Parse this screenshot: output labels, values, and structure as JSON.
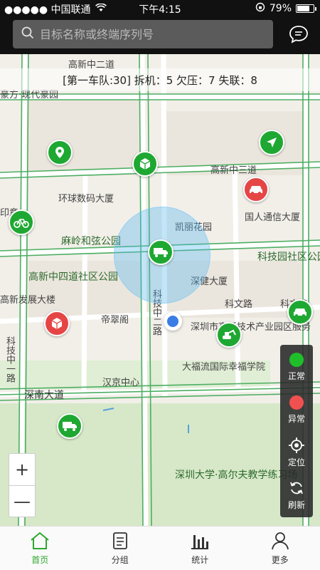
{
  "status_bar": {
    "carrier": "●●●●● 中国联通",
    "time": "下午4:15",
    "battery": "79%",
    "battery_level": 0.79
  },
  "search": {
    "placeholder": "目标名称或终端序列号"
  },
  "summary": {
    "text": "[第一车队:30]  拆机：5  欠压：7  失联：8"
  },
  "map": {
    "labels": {
      "gaoxin_zhong2": "高新中二道",
      "haofang": "豪方·现代豪园",
      "gaoxin_zhong3": "高新中三道",
      "huanqiu": "环球数码大厦",
      "guoren": "国人通信大厦",
      "maling": "麻岭和弦公园",
      "kaili": "凯丽花园",
      "kejiyuan": "科技园社区公园",
      "gaoxin_zhong4": "高新中四道社区公园",
      "shenjian": "深健大厦",
      "fazhan": "高新发展大楼",
      "kewen1": "科文路",
      "kewen2": "科文路",
      "dicui": "帝翠阁",
      "keji_zhong2": "科技中二路",
      "shenzhen_tech": "深圳市高新技术产业园区服务",
      "dafuliu": "大福流国际幸福学院",
      "hanjing": "汉京中心",
      "shennan": "深南大道",
      "shenda": "深圳大学·高尔夫教学练习场",
      "keji_zhong1": "科技中一路",
      "yinzhang": "印章",
      "road": "路"
    }
  },
  "controls": {
    "normal": "正常",
    "abnormal": "异常",
    "locate": "定位",
    "refresh": "刷新"
  },
  "zoom": {
    "plus": "+",
    "minus": "—"
  },
  "tabs": [
    {
      "label": "首页"
    },
    {
      "label": "分组"
    },
    {
      "label": "统计"
    },
    {
      "label": "更多"
    }
  ],
  "colors": {
    "active_tab": "#2ea82e",
    "marker_green": "#1ea832",
    "marker_red": "#e64545"
  }
}
